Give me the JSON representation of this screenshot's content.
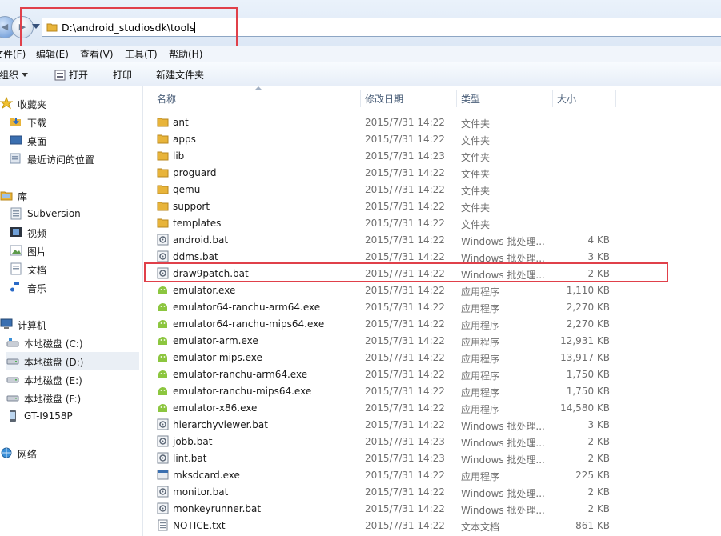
{
  "address": {
    "path": "D:\\android_studiosdk\\tools"
  },
  "menu": [
    "文件(F)",
    "编辑(E)",
    "查看(V)",
    "工具(T)",
    "帮助(H)"
  ],
  "toolbar": {
    "organize": "组织",
    "open": "打开",
    "print": "打印",
    "new_folder": "新建文件夹"
  },
  "sidebar": {
    "favorites": {
      "label": "收藏夹",
      "items": [
        "下载",
        "桌面",
        "最近访问的位置"
      ]
    },
    "libraries": {
      "label": "库",
      "items": [
        "Subversion",
        "视频",
        "图片",
        "文档",
        "音乐"
      ]
    },
    "computer": {
      "label": "计算机",
      "items": [
        "本地磁盘 (C:)",
        "本地磁盘 (D:)",
        "本地磁盘 (E:)",
        "本地磁盘 (F:)",
        "GT-I9158P"
      ]
    },
    "network": {
      "label": "网络"
    },
    "selected": "本地磁盘 (D:)"
  },
  "columns": {
    "name": "名称",
    "date": "修改日期",
    "type": "类型",
    "size": "大小"
  },
  "files": [
    {
      "name": "ant",
      "date": "2015/7/31 14:22",
      "type": "文件夹",
      "size": "",
      "kind": "folder"
    },
    {
      "name": "apps",
      "date": "2015/7/31 14:22",
      "type": "文件夹",
      "size": "",
      "kind": "folder"
    },
    {
      "name": "lib",
      "date": "2015/7/31 14:23",
      "type": "文件夹",
      "size": "",
      "kind": "folder"
    },
    {
      "name": "proguard",
      "date": "2015/7/31 14:22",
      "type": "文件夹",
      "size": "",
      "kind": "folder"
    },
    {
      "name": "qemu",
      "date": "2015/7/31 14:22",
      "type": "文件夹",
      "size": "",
      "kind": "folder"
    },
    {
      "name": "support",
      "date": "2015/7/31 14:22",
      "type": "文件夹",
      "size": "",
      "kind": "folder"
    },
    {
      "name": "templates",
      "date": "2015/7/31 14:22",
      "type": "文件夹",
      "size": "",
      "kind": "folder"
    },
    {
      "name": "android.bat",
      "date": "2015/7/31 14:22",
      "type": "Windows 批处理...",
      "size": "4 KB",
      "kind": "bat"
    },
    {
      "name": "ddms.bat",
      "date": "2015/7/31 14:22",
      "type": "Windows 批处理...",
      "size": "3 KB",
      "kind": "bat"
    },
    {
      "name": "draw9patch.bat",
      "date": "2015/7/31 14:22",
      "type": "Windows 批处理...",
      "size": "2 KB",
      "kind": "bat"
    },
    {
      "name": "emulator.exe",
      "date": "2015/7/31 14:22",
      "type": "应用程序",
      "size": "1,110 KB",
      "kind": "exe"
    },
    {
      "name": "emulator64-ranchu-arm64.exe",
      "date": "2015/7/31 14:22",
      "type": "应用程序",
      "size": "2,270 KB",
      "kind": "exe"
    },
    {
      "name": "emulator64-ranchu-mips64.exe",
      "date": "2015/7/31 14:22",
      "type": "应用程序",
      "size": "2,270 KB",
      "kind": "exe"
    },
    {
      "name": "emulator-arm.exe",
      "date": "2015/7/31 14:22",
      "type": "应用程序",
      "size": "12,931 KB",
      "kind": "exe"
    },
    {
      "name": "emulator-mips.exe",
      "date": "2015/7/31 14:22",
      "type": "应用程序",
      "size": "13,917 KB",
      "kind": "exe"
    },
    {
      "name": "emulator-ranchu-arm64.exe",
      "date": "2015/7/31 14:22",
      "type": "应用程序",
      "size": "1,750 KB",
      "kind": "exe"
    },
    {
      "name": "emulator-ranchu-mips64.exe",
      "date": "2015/7/31 14:22",
      "type": "应用程序",
      "size": "1,750 KB",
      "kind": "exe"
    },
    {
      "name": "emulator-x86.exe",
      "date": "2015/7/31 14:22",
      "type": "应用程序",
      "size": "14,580 KB",
      "kind": "exe"
    },
    {
      "name": "hierarchyviewer.bat",
      "date": "2015/7/31 14:22",
      "type": "Windows 批处理...",
      "size": "3 KB",
      "kind": "bat"
    },
    {
      "name": "jobb.bat",
      "date": "2015/7/31 14:23",
      "type": "Windows 批处理...",
      "size": "2 KB",
      "kind": "bat"
    },
    {
      "name": "lint.bat",
      "date": "2015/7/31 14:23",
      "type": "Windows 批处理...",
      "size": "2 KB",
      "kind": "bat"
    },
    {
      "name": "mksdcard.exe",
      "date": "2015/7/31 14:22",
      "type": "应用程序",
      "size": "225 KB",
      "kind": "exe2"
    },
    {
      "name": "monitor.bat",
      "date": "2015/7/31 14:22",
      "type": "Windows 批处理...",
      "size": "2 KB",
      "kind": "bat"
    },
    {
      "name": "monkeyrunner.bat",
      "date": "2015/7/31 14:22",
      "type": "Windows 批处理...",
      "size": "2 KB",
      "kind": "bat"
    },
    {
      "name": "NOTICE.txt",
      "date": "2015/7/31 14:22",
      "type": "文本文档",
      "size": "861 KB",
      "kind": "txt"
    }
  ],
  "colors": {
    "folder": "#e8b43a",
    "android_green": "#8cc63f",
    "highlight_box": "#e0404a"
  }
}
